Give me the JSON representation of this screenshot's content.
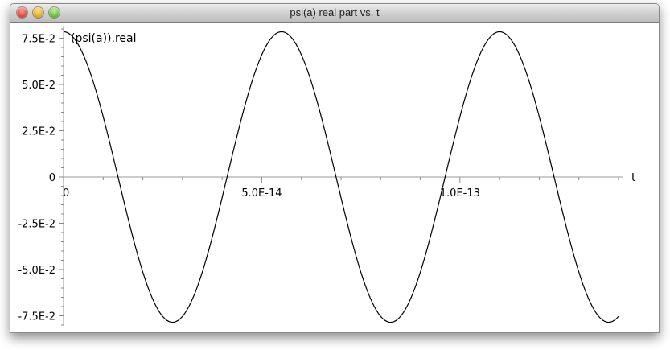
{
  "window": {
    "title": "psi(a) real part vs. t"
  },
  "chart_data": {
    "type": "line",
    "title": "",
    "xlabel": "t",
    "ylabel": "(psi(a)).real",
    "xlim": [
      0,
      1.4e-13
    ],
    "ylim": [
      -0.08,
      0.08
    ],
    "x_ticks": [
      {
        "value": 0,
        "label": "0"
      },
      {
        "value": 5e-14,
        "label": "5.0E-14"
      },
      {
        "value": 1e-13,
        "label": "1.0E-13"
      }
    ],
    "y_ticks": [
      {
        "value": 0.075,
        "label": "7.5E-2"
      },
      {
        "value": 0.05,
        "label": "5.0E-2"
      },
      {
        "value": 0.025,
        "label": "2.5E-2"
      },
      {
        "value": 0,
        "label": "0"
      },
      {
        "value": -0.025,
        "label": "-2.5E-2"
      },
      {
        "value": -0.05,
        "label": "-5.0E-2"
      },
      {
        "value": -0.075,
        "label": "-7.5E-2"
      }
    ],
    "grid": false,
    "series": [
      {
        "name": "(psi(a)).real",
        "color": "#000000",
        "x": [
          0,
          2.75e-14,
          5.5e-14,
          8.25e-14,
          1.1e-13,
          1.4e-13
        ],
        "y": [
          0.0785,
          -0.0785,
          0.0785,
          -0.0785,
          0.0785,
          -0.0678
        ]
      }
    ]
  }
}
